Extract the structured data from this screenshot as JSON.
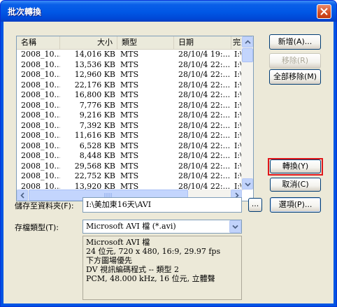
{
  "window": {
    "title": "批次轉換"
  },
  "columns": [
    "名稱",
    "大小",
    "類型",
    "日期",
    "完整"
  ],
  "rows": [
    [
      "2008_10...",
      "14,016 KB",
      "MTS",
      "28/10/4 19:...",
      "I:\\美"
    ],
    [
      "2008_10...",
      "13,536 KB",
      "MTS",
      "28/10/4 22:...",
      "I:\\美"
    ],
    [
      "2008_10...",
      "12,960 KB",
      "MTS",
      "28/10/4 22:...",
      "I:\\美"
    ],
    [
      "2008_10...",
      "22,176 KB",
      "MTS",
      "28/10/4 22:...",
      "I:\\美"
    ],
    [
      "2008_10...",
      "16,800 KB",
      "MTS",
      "28/10/4 22:...",
      "I:\\美"
    ],
    [
      "2008_10...",
      "7,776 KB",
      "MTS",
      "28/10/4 22:...",
      "I:\\美"
    ],
    [
      "2008_10...",
      "9,216 KB",
      "MTS",
      "28/10/4 22:...",
      "I:\\美"
    ],
    [
      "2008_10...",
      "7,392 KB",
      "MTS",
      "28/10/4 22:...",
      "I:\\美"
    ],
    [
      "2008_10...",
      "11,616 KB",
      "MTS",
      "28/10/4 22:...",
      "I:\\美"
    ],
    [
      "2008_10...",
      "6,528 KB",
      "MTS",
      "28/10/4 22:...",
      "I:\\美"
    ],
    [
      "2008_10...",
      "8,448 KB",
      "MTS",
      "28/10/4 22:...",
      "I:\\美"
    ],
    [
      "2008_10...",
      "29,568 KB",
      "MTS",
      "28/10/4 22:...",
      "I:\\美"
    ],
    [
      "2008_10...",
      "22,752 KB",
      "MTS",
      "28/10/4 22:...",
      "I:\\美"
    ],
    [
      "2008_10...",
      "13,920 KB",
      "MTS",
      "28/10/4 22:...",
      "I:\\美"
    ]
  ],
  "buttons": {
    "add": "新增(A)...",
    "remove": "移除(R)",
    "remove_all": "全部移除(M)",
    "convert": "轉換(Y)",
    "cancel": "取消(C)",
    "browse": "...",
    "options": "選項(P)..."
  },
  "save_folder": {
    "label": "儲存至資料夾(F):",
    "value": "I:\\美加東16天\\AVI"
  },
  "file_type": {
    "label": "存檔類型(T):",
    "value": "Microsoft AVI 檔 (*.avi)"
  },
  "info_lines": [
    "Microsoft AVI 檔",
    "24 位元, 720 x 480, 16:9, 29.97 fps",
    "下方圖場優先",
    "DV 視訊編碼程式 -- 類型 2",
    "PCM, 48.000 kHz, 16 位元, 立體聲"
  ],
  "colors": {
    "titlebar": "#0054e3",
    "highlight_border": "#e0161a",
    "dialog_bg": "#ece9d8"
  }
}
